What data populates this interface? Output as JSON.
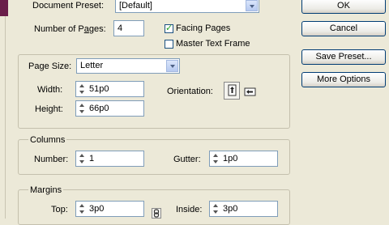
{
  "document_preset": {
    "label": "Document Preset:",
    "value": "[Default]"
  },
  "number_of_pages": {
    "label_before": "Number of P",
    "label_acc": "a",
    "label_after": "ges:",
    "value": "4"
  },
  "facing_pages": {
    "label": "Facing Pages",
    "checked": true
  },
  "master_text_frame": {
    "label": "Master Text Frame",
    "checked": false
  },
  "page_size": {
    "label": "Page Size:",
    "value": "Letter",
    "width_label": "Width:",
    "width_value": "51p0",
    "height_label": "Height:",
    "height_value": "66p0",
    "orientation_label": "Orientation:"
  },
  "columns": {
    "title": "Columns",
    "number_label": "Number:",
    "number_value": "1",
    "gutter_label": "Gutter:",
    "gutter_value": "1p0"
  },
  "margins": {
    "title": "Margins",
    "top_label": "Top:",
    "top_value": "3p0",
    "inside_label": "Inside:",
    "inside_value": "3p0"
  },
  "buttons": {
    "ok": "OK",
    "cancel": "Cancel",
    "save_preset": "Save Preset...",
    "more_options": "More Options"
  },
  "icons": {
    "portrait": "portrait-orientation-icon",
    "landscape": "landscape-orientation-icon",
    "link": "chain-link-icon"
  }
}
